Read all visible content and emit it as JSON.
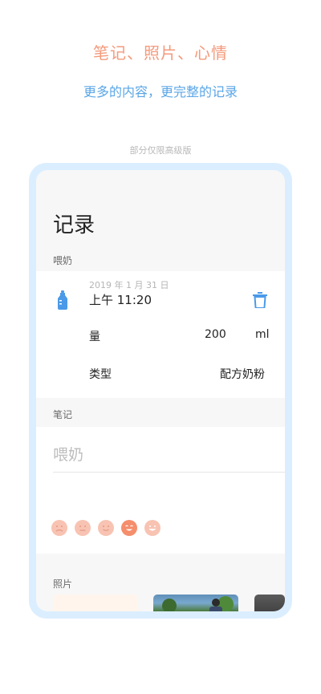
{
  "promo": {
    "headline": "笔记、照片、心情",
    "subline": "更多的内容，更完整的记录",
    "note": "部分仅限高级版"
  },
  "screen": {
    "title": "记录",
    "section_feed": "喂奶",
    "entry": {
      "date": "2019 年 1 月 31 日",
      "time": "上午 11:20",
      "amount_label": "量",
      "amount_value": "200",
      "amount_unit": "ml",
      "type_label": "类型",
      "type_value": "配方奶粉"
    },
    "section_note": "笔记",
    "note_text": "喂奶",
    "moods": [
      "sad-face",
      "neutral-face",
      "slight-smile-face",
      "happy-face",
      "big-smile-face"
    ],
    "section_photos": "照片"
  },
  "colors": {
    "accent_orange": "#f49a7c",
    "accent_blue": "#5aa6e6",
    "frame_blue": "#dbeeff",
    "mood_faded": "#f8c3b2",
    "mood_active": "#f58e6c"
  }
}
